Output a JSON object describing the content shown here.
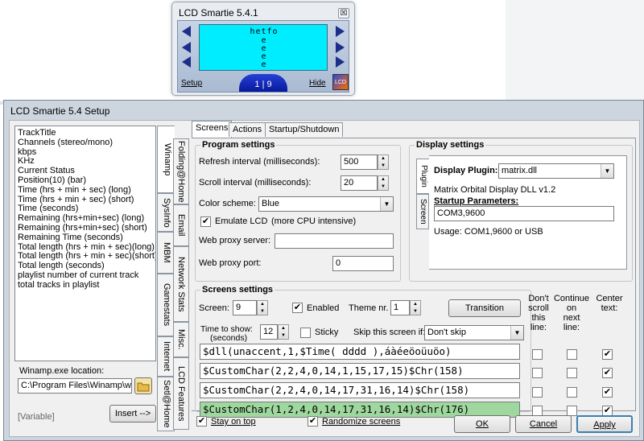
{
  "mini_window": {
    "title": "LCD Smartie 5.4.1",
    "close": "☒",
    "lcd_lines": [
      "hetfo",
      "e",
      "e",
      "e",
      "e"
    ],
    "setup_label": "Setup",
    "hide_label": "Hide",
    "page": "1 | 9",
    "logo": "LCD"
  },
  "setup_window": {
    "title": "LCD Smartie 5.4 Setup"
  },
  "variables": {
    "items": [
      "TrackTitle",
      "Channels (stereo/mono)",
      "kbps",
      "KHz",
      "Current Status",
      "Position(10) (bar)",
      "Time (hrs + min + sec) (long)",
      "Time (hrs + min + sec) (short)",
      "Time (seconds)",
      "Remaining (hrs+min+sec) (long)",
      "Remaining (hrs+min+sec) (short)",
      "Remaining Time (seconds)",
      "Total length (hrs + min + sec)(long)",
      "Total length (hrs + min + sec)(short)",
      "Total length (seconds)",
      "playlist number of current track",
      "total tracks in playlist"
    ],
    "exe_label": "Winamp.exe location:",
    "exe_path": "C:\\Program Files\\Winamp\\wina",
    "variable_hint": "[Variable]",
    "insert_label": "Insert -->"
  },
  "vertical_tabs": {
    "col1": [
      "Winamp",
      "SysInfo",
      "MBM",
      "Gamestats",
      "Internet",
      "Setl@Home"
    ],
    "col2": [
      "Folding@Home",
      "Email",
      "Network Stats",
      "Misc.",
      "LCD Features"
    ]
  },
  "main_tabs": [
    "Screens",
    "Actions",
    "Startup/Shutdown"
  ],
  "program_settings": {
    "title": "Program settings",
    "refresh_label": "Refresh interval (milliseconds):",
    "refresh_value": "500",
    "scroll_label": "Scroll interval (milliseconds):",
    "scroll_value": "20",
    "color_label": "Color scheme:",
    "color_value": "Blue",
    "emulate_label": "Emulate LCD",
    "emulate_note": "(more CPU intensive)",
    "emulate_checked": "✔",
    "proxy_server_label": "Web proxy server:",
    "proxy_server_value": "",
    "proxy_port_label": "Web proxy port:",
    "proxy_port_value": "0"
  },
  "display_settings": {
    "title": "Display settings",
    "tabs": [
      "Plugin",
      "Screen"
    ],
    "plugin_label": "Display Plugin:",
    "plugin_value": "matrix.dll",
    "plugin_desc": "Matrix Orbital Display DLL v1.2",
    "startup_label": "Startup Parameters:",
    "startup_value": "COM3,9600",
    "usage": "Usage: COM1,9600 or USB"
  },
  "screens_settings": {
    "title": "Screens settings",
    "screen_label": "Screen:",
    "screen_value": "9",
    "enabled_label": "Enabled",
    "enabled_checked": "✔",
    "theme_label": "Theme nr.",
    "theme_value": "1",
    "transition_label": "Transition",
    "time_label_1": "Time to show:",
    "time_label_2": "(seconds)",
    "time_value": "12",
    "sticky_label": "Sticky",
    "skip_label": "Skip this screen if:",
    "skip_value": "Don't skip",
    "col_dont_scroll": [
      "Don't",
      "scroll",
      "this",
      "line:"
    ],
    "col_continue": [
      "Continue",
      "on",
      "next",
      "line:"
    ],
    "col_center": [
      "Center",
      "text:"
    ],
    "lines": [
      {
        "text": "$dll(unaccent,1,$Time( dddd ),áàéeöoüuöo)",
        "center": "✔"
      },
      {
        "text": "$CustomChar(2,2,4,0,14,1,15,17,15)$Chr(158)",
        "center": "✔"
      },
      {
        "text": "$CustomChar(2,2,4,0,14,17,31,16,14)$Chr(158)",
        "center": "✔"
      },
      {
        "text": "$CustomChar(1,2,4,0,14,17,31,16,14)$Chr(176)",
        "center": "✔"
      }
    ]
  },
  "footer": {
    "stay_on_top_label": "Stay on top",
    "stay_on_top_checked": "✔",
    "randomize_label": "Randomize screens",
    "randomize_checked": "✔",
    "ok_label": "OK",
    "cancel_label": "Cancel",
    "apply_label": "Apply"
  }
}
